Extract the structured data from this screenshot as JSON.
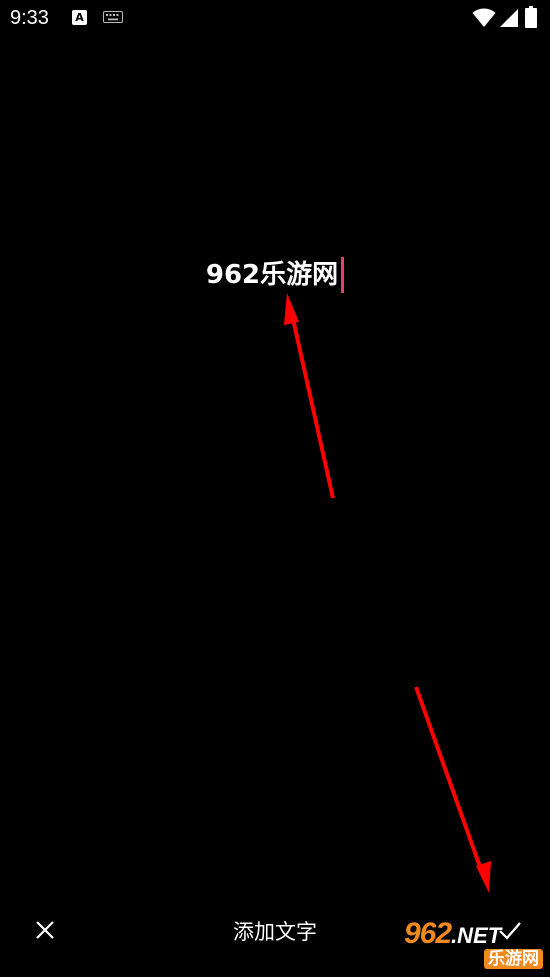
{
  "status_bar": {
    "time": "9:33",
    "input_indicator": "A"
  },
  "canvas": {
    "text": "962乐游网"
  },
  "bottom_bar": {
    "title": "添加文字",
    "close_icon": "close-icon",
    "confirm_icon": "check-icon"
  },
  "watermark": {
    "digits": "962",
    "suffix": ".NET",
    "site": "乐游网"
  },
  "colors": {
    "background": "#000000",
    "caret": "#e0446a",
    "annotation_arrow": "#ff0000",
    "watermark_orange": "#f08a1c"
  }
}
